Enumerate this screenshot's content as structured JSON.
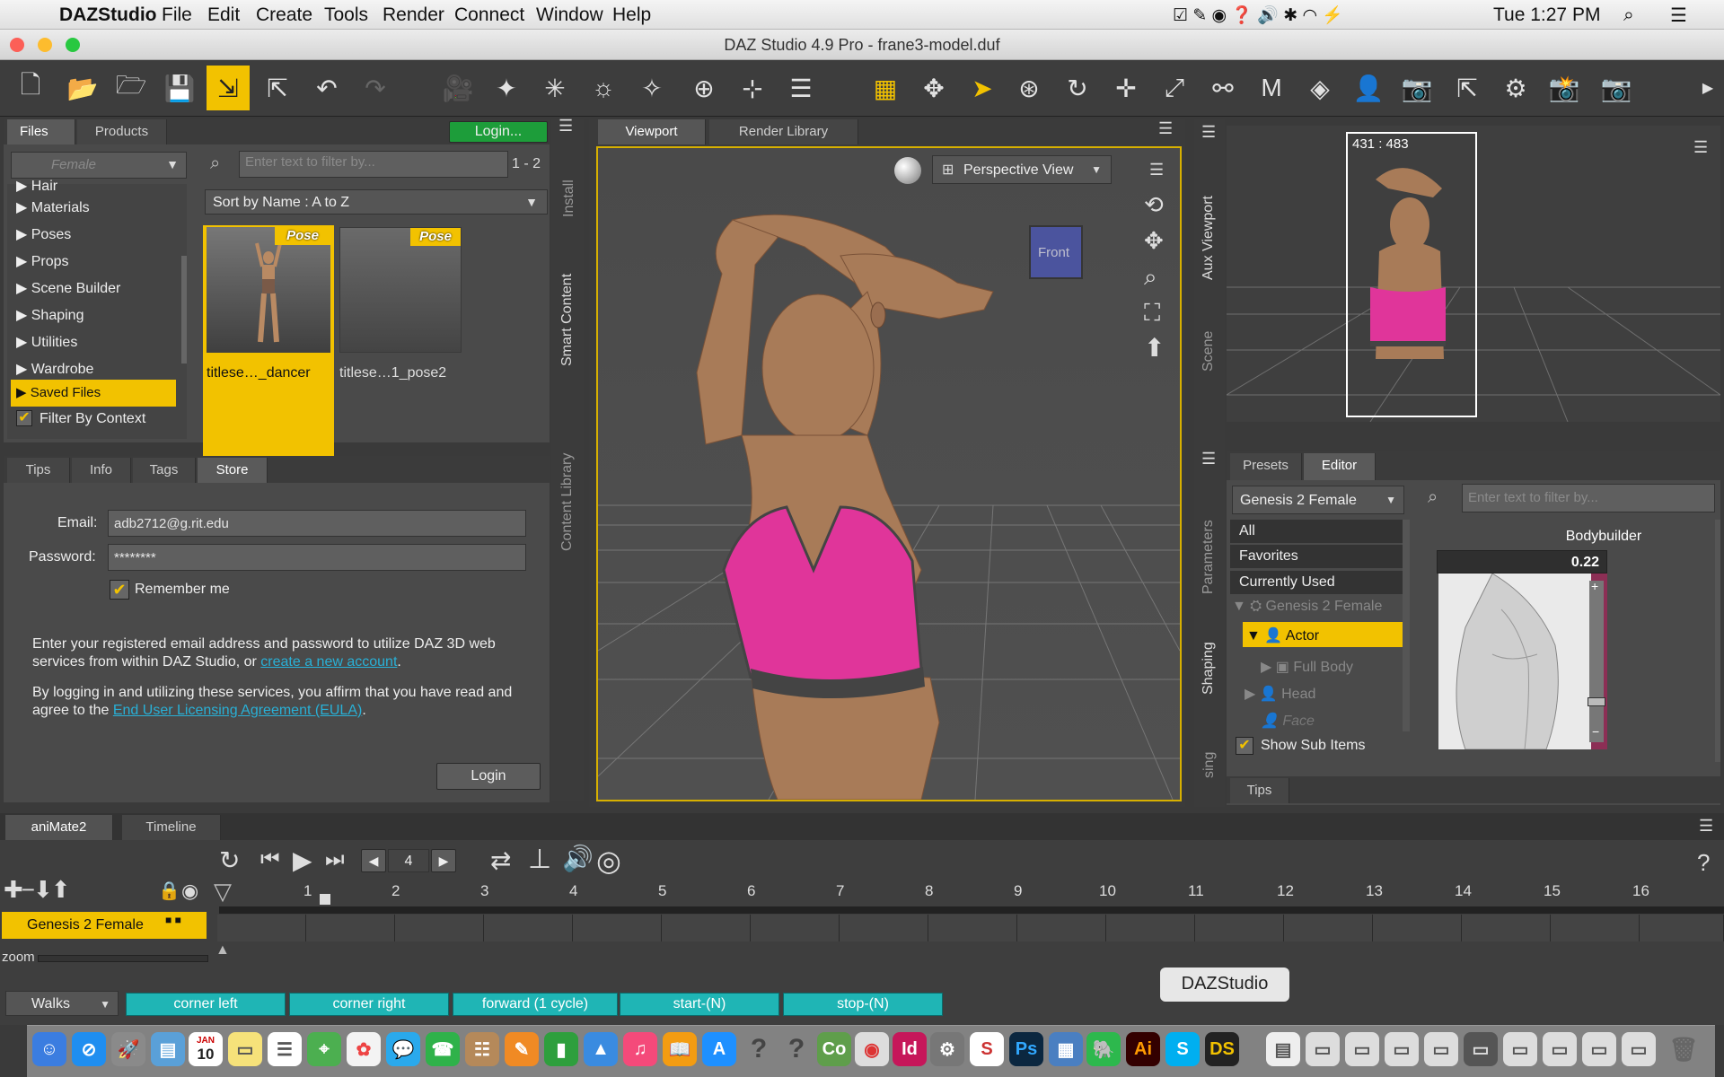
{
  "menubar": {
    "app": "DAZStudio",
    "items": [
      "File",
      "Edit",
      "Create",
      "Tools",
      "Render",
      "Connect",
      "Window",
      "Help"
    ],
    "clock": "Tue 1:27 PM"
  },
  "window": {
    "title": "DAZ Studio 4.9 Pro - frane3-model.duf"
  },
  "files_panel": {
    "tabs": [
      "Files",
      "Products"
    ],
    "login_button": "Login...",
    "category_dropdown": "Female",
    "filter_placeholder": "Enter text to filter by...",
    "result_count": "1 - 2",
    "sort": "Sort by Name : A to Z",
    "tree": [
      "Hair",
      "Materials",
      "Poses",
      "Props",
      "Scene Builder",
      "Shaping",
      "Utilities",
      "Wardrobe",
      "Saved Files"
    ],
    "filter_by_context": "Filter By Context",
    "thumbs": [
      {
        "badge": "Pose",
        "label": "titlese…_dancer"
      },
      {
        "badge": "Pose",
        "label": "titlese…1_pose2"
      }
    ]
  },
  "store_panel": {
    "tabs": [
      "Tips",
      "Info",
      "Tags",
      "Store"
    ],
    "email_label": "Email:",
    "email_value": "adb2712@g.rit.edu",
    "password_label": "Password:",
    "password_value": "********",
    "remember": "Remember me",
    "para1_a": "Enter your registered email address and password to utilize DAZ 3D web services from within DAZ Studio, or ",
    "para1_link": "create a new account",
    "para1_b": ".",
    "para2_a": "By logging in and utilizing these services, you affirm that you have read and agree to the ",
    "para2_link": "End User Licensing Agreement (EULA)",
    "para2_b": ".",
    "login": "Login"
  },
  "side_tabs_left": [
    "Install",
    "Smart Content",
    "Content Library"
  ],
  "viewport": {
    "tabs": [
      "Viewport",
      "Render Library"
    ],
    "view": "Perspective View",
    "cube_label": "Front"
  },
  "aux": {
    "dims": "431 : 483",
    "side_tabs": [
      "Aux Viewport",
      "Scene"
    ]
  },
  "params": {
    "tabs": [
      "Presets",
      "Editor"
    ],
    "figure": "Genesis 2 Female",
    "filter_placeholder": "Enter text to filter by...",
    "list": [
      "All",
      "Favorites",
      "Currently Used"
    ],
    "tree": {
      "root": "Genesis 2 Female",
      "actor": "Actor",
      "full_body": "Full Body",
      "head": "Head",
      "face": "Face"
    },
    "show_sub": "Show Sub Items",
    "slider_name": "Bodybuilder",
    "slider_value": "0.22",
    "tips": "Tips",
    "side_tabs": [
      "Parameters",
      "Shaping",
      "sing"
    ]
  },
  "timeline": {
    "tabs": [
      "aniMate2",
      "Timeline"
    ],
    "frame": "4",
    "ticks": [
      "1",
      "2",
      "3",
      "4",
      "5",
      "6",
      "7",
      "8",
      "9",
      "10",
      "11",
      "12",
      "13",
      "14",
      "15",
      "16"
    ],
    "track": "Genesis 2 Female",
    "zoom": "zoom",
    "category": "Walks",
    "clips": [
      "corner left",
      "corner right",
      "forward (1 cycle)",
      "start-(N)",
      "stop-(N)"
    ]
  },
  "dock": {
    "tooltip": "DAZStudio",
    "calendar_day": "10",
    "calendar_month": "JAN"
  },
  "colors": {
    "accent": "#f2c200",
    "clip": "#1fb5b5",
    "bra": "#e0359a"
  }
}
